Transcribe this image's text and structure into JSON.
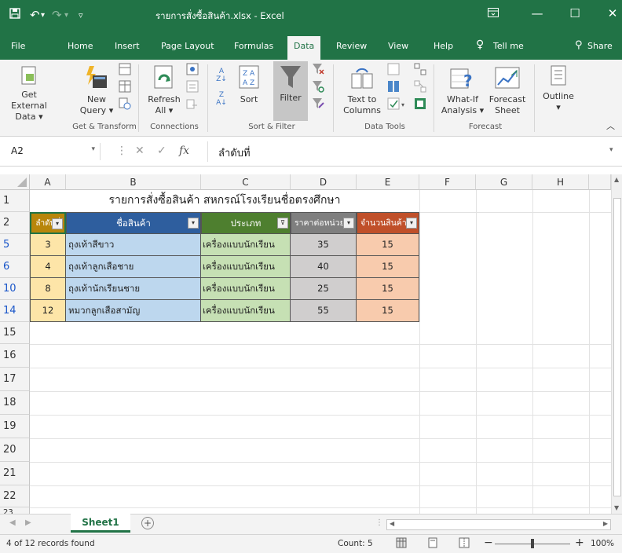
{
  "window": {
    "title": "รายการสั่งซื้อสินค้า.xlsx  -  Excel",
    "accent": "#217346"
  },
  "quick_access": [
    "save-icon",
    "undo-icon",
    "redo-icon",
    "customize-icon"
  ],
  "tabs": [
    {
      "label": "File"
    },
    {
      "label": "Home"
    },
    {
      "label": "Insert"
    },
    {
      "label": "Page Layout"
    },
    {
      "label": "Formulas"
    },
    {
      "label": "Data",
      "active": true
    },
    {
      "label": "Review"
    },
    {
      "label": "View"
    },
    {
      "label": "Help"
    },
    {
      "label": "Tell me"
    },
    {
      "label": "Share"
    }
  ],
  "ribbon": {
    "get_external": "Get External",
    "get_external2": "Data ▾",
    "new_query": "New",
    "new_query2": "Query ▾",
    "refresh": "Refresh",
    "refresh2": "All ▾",
    "sort": "Sort",
    "filter": "Filter",
    "text_to_columns": "Text to",
    "text_to_columns2": "Columns",
    "whatif": "What-If",
    "whatif2": "Analysis ▾",
    "forecast": "Forecast",
    "forecast2": "Sheet",
    "outline": "Outline",
    "outline2": "▾",
    "groups": {
      "get_transform": "Get & Transform",
      "connections": "Connections",
      "sort_filter": "Sort & Filter",
      "data_tools": "Data Tools",
      "forecast": "Forecast"
    }
  },
  "formula_bar": {
    "name_box": "A2",
    "value": "ลำดับที่",
    "fx": "fx"
  },
  "columns": [
    "A",
    "B",
    "C",
    "D",
    "E",
    "F",
    "G",
    "H"
  ],
  "sheet": {
    "title": "รายการสั่งซื้อสินค้า สหกรณ์โรงเรียนชื่อตรงศึกษา",
    "headers": [
      "ลำดับที่",
      "ชื่อสินค้า",
      "ประเภท",
      "ราคาต่อหน่วย",
      "จำนวนสินค้า"
    ],
    "header_colors": [
      "#b8860b",
      "#2e5e9e",
      "#4e7f2f",
      "#7f7f7f",
      "#c0502a"
    ],
    "body_colors": [
      "#fde5a8",
      "#bdd7ee",
      "#c6e0b4",
      "#d0cece",
      "#f8cbad"
    ],
    "rows": [
      {
        "row": "5",
        "cells": [
          "3",
          "ถุงเท้าสีขาว",
          "เครื่องแบบนักเรียน",
          "35",
          "15"
        ]
      },
      {
        "row": "6",
        "cells": [
          "4",
          "ถุงเท้าลูกเสือชาย",
          "เครื่องแบบนักเรียน",
          "40",
          "15"
        ]
      },
      {
        "row": "10",
        "cells": [
          "8",
          "ถุงเท้านักเรียนชาย",
          "เครื่องแบบนักเรียน",
          "25",
          "15"
        ]
      },
      {
        "row": "14",
        "cells": [
          "12",
          "หมวกลูกเสือสามัญ",
          "เครื่องแบบนักเรียน",
          "55",
          "15"
        ]
      }
    ],
    "empty_rows": [
      "15",
      "16",
      "17",
      "18",
      "19",
      "20",
      "21",
      "22",
      "23"
    ],
    "title_row": "1",
    "header_row": "2"
  },
  "sheet_tabs": {
    "active": "Sheet1",
    "add": "+"
  },
  "status": {
    "records": "4 of 12 records found",
    "count": "Count: 5",
    "zoom": "100%"
  }
}
